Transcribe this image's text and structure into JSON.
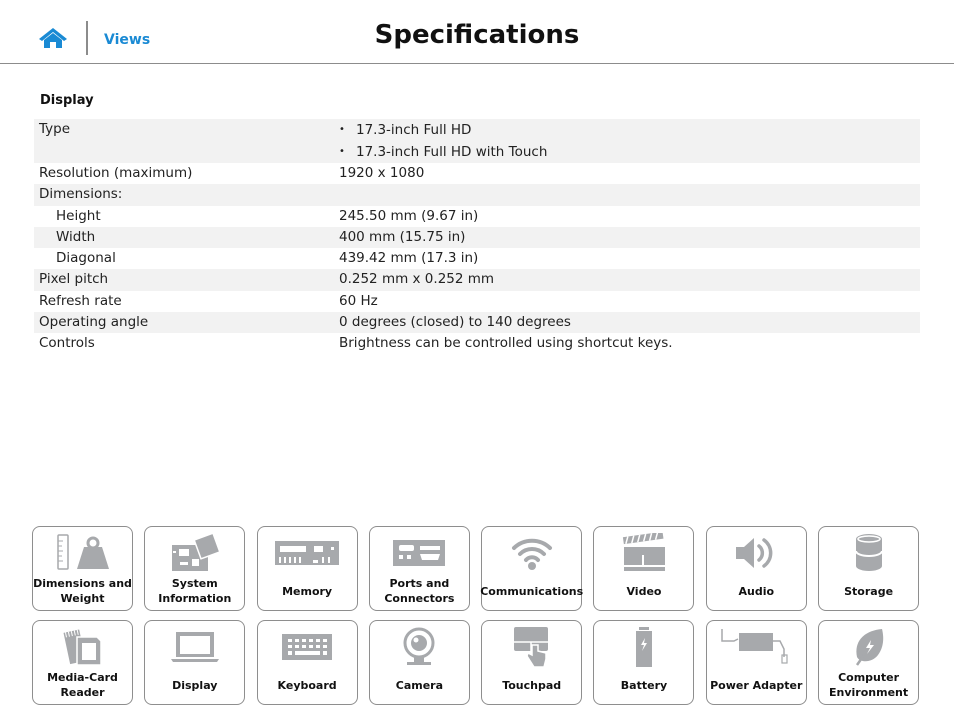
{
  "header": {
    "home_label": "Home",
    "views_link": "Views",
    "title": "Specifications"
  },
  "section": {
    "title": "Display"
  },
  "specs": {
    "type": {
      "label": "Type",
      "values": [
        "17.3-inch Full HD",
        "17.3-inch Full HD with Touch"
      ]
    },
    "resolution": {
      "label": "Resolution (maximum)",
      "value": "1920 x 1080"
    },
    "dimensions": {
      "label": "Dimensions:",
      "value": ""
    },
    "height": {
      "label": "Height",
      "value": "245.50 mm (9.67 in)"
    },
    "width": {
      "label": "Width",
      "value": "400 mm (15.75 in)"
    },
    "diagonal": {
      "label": "Diagonal",
      "value": "439.42 mm (17.3 in)"
    },
    "pixel_pitch": {
      "label": "Pixel pitch",
      "value": "0.252 mm x 0.252 mm"
    },
    "refresh_rate": {
      "label": "Refresh rate",
      "value": "60 Hz"
    },
    "operating_angle": {
      "label": "Operating angle",
      "value": "0 degrees (closed) to 140 degrees"
    },
    "controls": {
      "label": "Controls",
      "value": "Brightness can be controlled using shortcut keys."
    }
  },
  "tiles": [
    {
      "label": "Dimensions and Weight",
      "icon": "ruler-weight-icon"
    },
    {
      "label": "System Information",
      "icon": "circuit-board-icon"
    },
    {
      "label": "Memory",
      "icon": "memory-module-icon"
    },
    {
      "label": "Ports and Connectors",
      "icon": "ports-icon"
    },
    {
      "label": "Communications",
      "icon": "wifi-icon"
    },
    {
      "label": "Video",
      "icon": "clapperboard-icon"
    },
    {
      "label": "Audio",
      "icon": "speaker-icon"
    },
    {
      "label": "Storage",
      "icon": "storage-cylinder-icon"
    },
    {
      "label": "Media-Card Reader",
      "icon": "sd-card-icon"
    },
    {
      "label": "Display",
      "icon": "laptop-icon"
    },
    {
      "label": "Keyboard",
      "icon": "keyboard-icon"
    },
    {
      "label": "Camera",
      "icon": "webcam-icon"
    },
    {
      "label": "Touchpad",
      "icon": "touchpad-icon"
    },
    {
      "label": "Battery",
      "icon": "battery-icon"
    },
    {
      "label": "Power Adapter",
      "icon": "power-adapter-icon"
    },
    {
      "label": "Computer Environment",
      "icon": "leaf-icon"
    }
  ],
  "colors": {
    "accent": "#1a8ad4",
    "icon_gray": "#a7a9ac",
    "row_stripe": "#f2f2f2"
  }
}
